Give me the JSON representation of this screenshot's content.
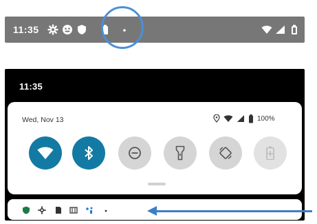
{
  "status_bar": {
    "time": "11:35",
    "icons": [
      "gear-icon",
      "face-icon",
      "shield-icon",
      "battery-saver-icon",
      "dot-icon",
      "wifi-icon",
      "signal-icon",
      "battery-icon"
    ]
  },
  "shade": {
    "time": "11:35",
    "date": "Wed, Nov 13",
    "battery_percent": "100%",
    "tiles": [
      {
        "name": "wifi",
        "state": "on"
      },
      {
        "name": "bluetooth",
        "state": "on"
      },
      {
        "name": "do-not-disturb",
        "state": "off"
      },
      {
        "name": "flashlight",
        "state": "off"
      },
      {
        "name": "auto-rotate",
        "state": "off"
      },
      {
        "name": "battery-saver",
        "state": "unavailable"
      }
    ]
  },
  "notification_icons": [
    "shield-icon",
    "gear-icon",
    "sim-icon",
    "cast-icon",
    "network-icon",
    "dot-icon"
  ],
  "colors": {
    "status_bar_bg": "#777777",
    "tile_on": "#137aa3",
    "tile_off": "#d5d5d5",
    "annotation_blue": "#3b7fc4"
  }
}
